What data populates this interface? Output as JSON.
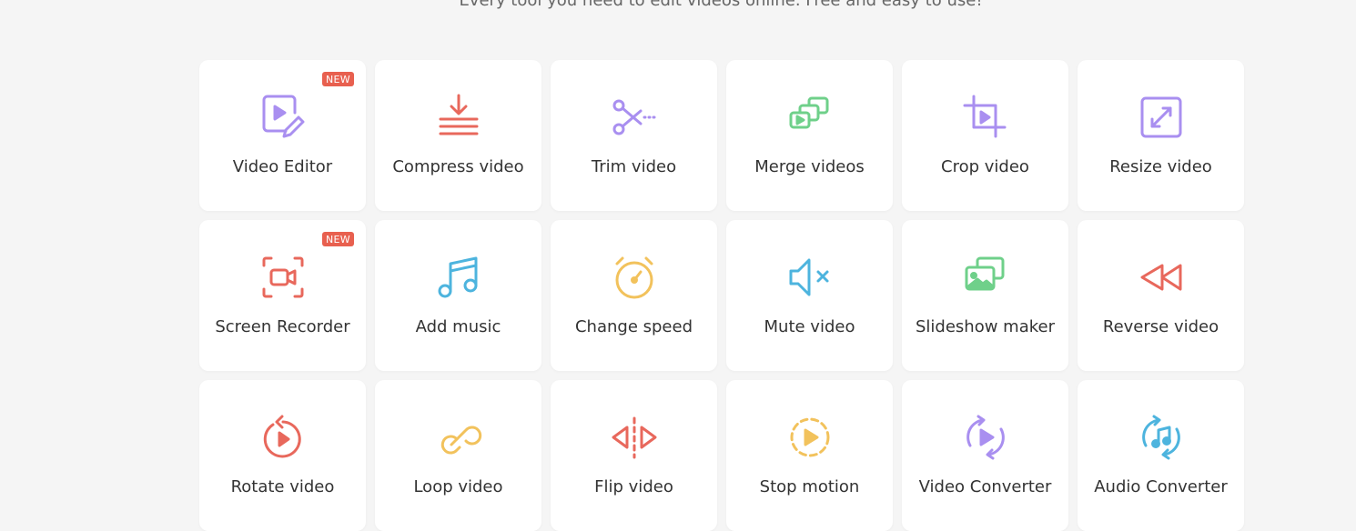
{
  "header": {
    "subtitle": "Every tool you need to edit videos online. Free and easy to use!"
  },
  "colors": {
    "purple": "#a98ff0",
    "red": "#e8685c",
    "green": "#6fd08a",
    "blue": "#4db4de",
    "yellow": "#f2c25c",
    "badge": "#e8604f"
  },
  "tools": [
    {
      "label": "Video Editor",
      "icon": "video-editor-icon",
      "badge": "NEW"
    },
    {
      "label": "Compress video",
      "icon": "compress-icon"
    },
    {
      "label": "Trim video",
      "icon": "scissors-icon"
    },
    {
      "label": "Merge videos",
      "icon": "merge-icon"
    },
    {
      "label": "Crop video",
      "icon": "crop-icon"
    },
    {
      "label": "Resize video",
      "icon": "resize-icon"
    },
    {
      "label": "Screen Recorder",
      "icon": "screen-recorder-icon",
      "badge": "NEW"
    },
    {
      "label": "Add music",
      "icon": "music-note-icon"
    },
    {
      "label": "Change speed",
      "icon": "stopwatch-icon"
    },
    {
      "label": "Mute video",
      "icon": "mute-icon"
    },
    {
      "label": "Slideshow maker",
      "icon": "slideshow-icon"
    },
    {
      "label": "Reverse video",
      "icon": "rewind-icon"
    },
    {
      "label": "Rotate video",
      "icon": "rotate-icon"
    },
    {
      "label": "Loop video",
      "icon": "loop-icon"
    },
    {
      "label": "Flip video",
      "icon": "flip-icon"
    },
    {
      "label": "Stop motion",
      "icon": "stop-motion-icon"
    },
    {
      "label": "Video Converter",
      "icon": "video-converter-icon"
    },
    {
      "label": "Audio Converter",
      "icon": "audio-converter-icon"
    }
  ]
}
